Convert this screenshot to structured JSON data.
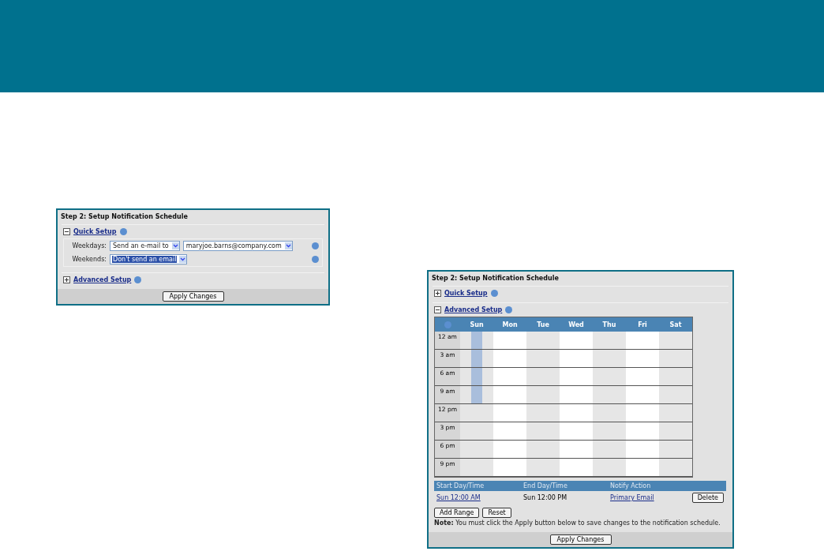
{
  "panels": [
    {
      "title": "Step 2: Setup Notification Schedule",
      "sections": [
        {
          "kind": "quick",
          "label": "Quick Setup",
          "expanded": true,
          "rows": [
            {
              "label": "Weekdays:",
              "selects": [
                {
                  "value": "Send an e-mail to",
                  "highlighted": false
                },
                {
                  "value": "maryjoe.barns@company.com",
                  "highlighted": false
                }
              ]
            },
            {
              "label": "Weekends:",
              "selects": [
                {
                  "value": "Don't send an email",
                  "highlighted": true
                }
              ]
            }
          ]
        },
        {
          "kind": "advanced",
          "label": "Advanced Setup",
          "expanded": false
        }
      ],
      "apply": "Apply Changes"
    },
    {
      "title": "Step 2: Setup Notification Schedule",
      "sections": [
        {
          "kind": "quick",
          "label": "Quick Setup",
          "expanded": false
        },
        {
          "kind": "advanced",
          "label": "Advanced Setup",
          "expanded": true,
          "days": [
            {
              "label": "Sun",
              "selected": true
            },
            {
              "label": "Mon",
              "selected": false
            },
            {
              "label": "Tue",
              "selected": false
            },
            {
              "label": "Wed",
              "selected": false
            },
            {
              "label": "Thu",
              "selected": false
            },
            {
              "label": "Fri",
              "selected": false
            },
            {
              "label": "Sat",
              "selected": false
            }
          ],
          "times": [
            {
              "label": "12 am",
              "highlighted": true
            },
            {
              "label": "3 am",
              "highlighted": true
            },
            {
              "label": "6 am",
              "highlighted": true
            },
            {
              "label": "9 am",
              "highlighted": true
            },
            {
              "label": "12 pm",
              "highlighted": false
            },
            {
              "label": "3 pm",
              "highlighted": false
            },
            {
              "label": "6 pm",
              "highlighted": false
            },
            {
              "label": "9 pm",
              "highlighted": false
            }
          ],
          "range_columns": [
            "Start Day/Time",
            "End Day/Time",
            "Notify Action"
          ],
          "ranges": [
            {
              "start": "Sun 12:00 AM",
              "end": "Sun 12:00 PM",
              "action": "Primary Email",
              "delete": "Delete"
            }
          ],
          "buttons": [
            "Add Range",
            "Reset"
          ],
          "note": "**Note:** You must click the Apply button below to save changes to the notification schedule."
        }
      ],
      "apply": "Apply Changes"
    }
  ]
}
